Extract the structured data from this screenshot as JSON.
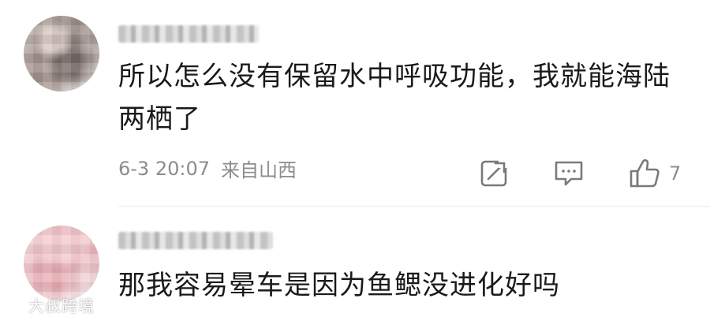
{
  "comments": [
    {
      "username": "",
      "text": "所以怎么没有保留水中呼吸功能，我就能海陆两栖了",
      "date": "6-3 20:07",
      "location": "来自山西",
      "likes": "7",
      "icons": {
        "share": "share-icon",
        "comment": "comment-icon",
        "like": "thumbs-up-icon"
      }
    },
    {
      "username": "",
      "text": "那我容易晕车是因为鱼鳃没进化好吗"
    }
  ],
  "watermark": {
    "text": "大叔跨境"
  },
  "colors": {
    "text": "#1a1a1a",
    "meta": "#8c8c8c",
    "icon": "#7a7a7a",
    "divider": "#ececec"
  }
}
